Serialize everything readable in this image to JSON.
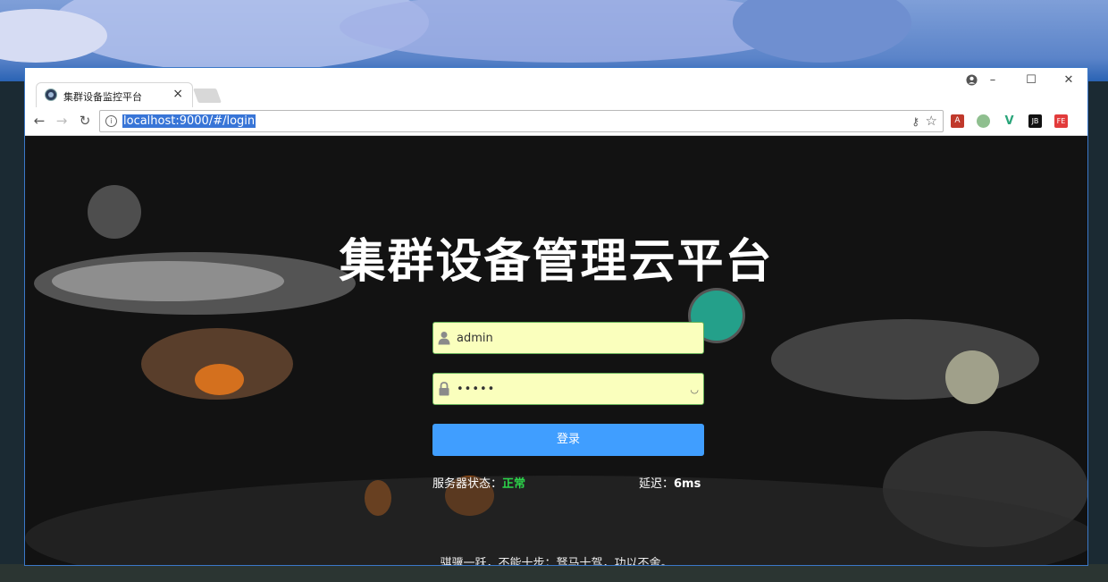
{
  "browser": {
    "tab_title": "集群设备监控平台",
    "tab_close": "×",
    "url": "localhost:9000/#/login",
    "nav": {
      "back": "←",
      "forward": "→",
      "reload": "↻"
    },
    "window_controls": {
      "minimize": "–",
      "maximize": "☐",
      "close": "✕"
    },
    "extensions": [
      "A",
      "",
      "V",
      "JB",
      "FE"
    ]
  },
  "page": {
    "title": "集群设备管理云平台",
    "username": {
      "value": "admin",
      "placeholder": ""
    },
    "password": {
      "value": "•••••"
    },
    "login_button": "登录",
    "status_label": "服务器状态：",
    "status_value": "正常",
    "delay_label": "延迟：",
    "delay_value": "6ms",
    "motto": "骐骥一跃，不能十步；驽马十驾，功以不舍。"
  },
  "colors": {
    "primary": "#409eff",
    "status_ok": "#2cd44a",
    "autofill": "#faffbd"
  }
}
